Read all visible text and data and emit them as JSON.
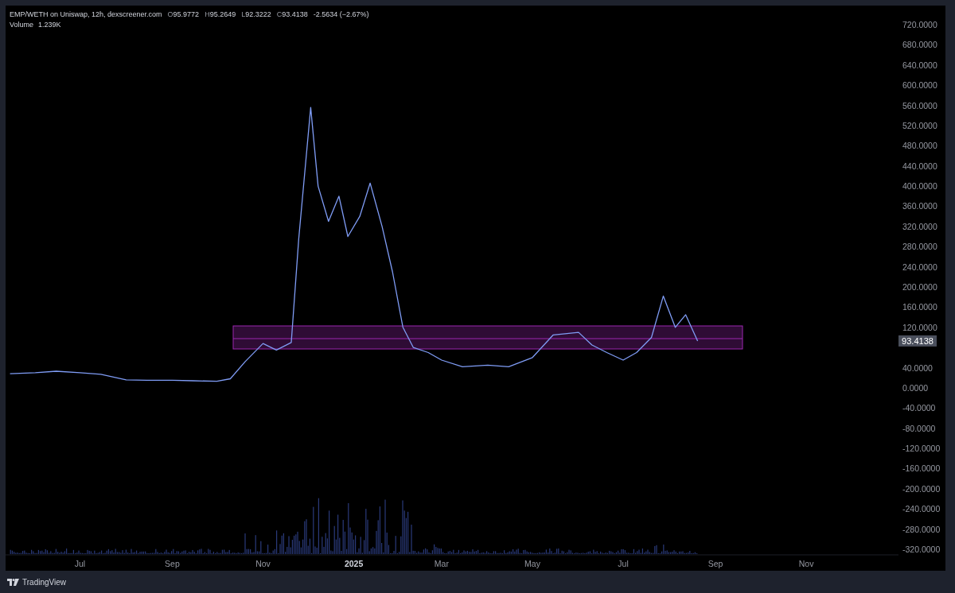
{
  "header": {
    "title": "EMP/WETH on Uniswap, 12h, dexscreener.com",
    "ohlc": [
      {
        "label": "O",
        "value": "95.9772"
      },
      {
        "label": "H",
        "value": "95.2649"
      },
      {
        "label": "L",
        "value": "92.3222"
      },
      {
        "label": "C",
        "value": "93.4138"
      }
    ],
    "change": "-2.5634 (−2.67%)",
    "volume_label": "Volume",
    "volume_value": "1.239K"
  },
  "chart_data": {
    "type": "line",
    "x": [
      "2024-05-15",
      "2024-06-01",
      "2024-06-15",
      "2024-07-01",
      "2024-07-15",
      "2024-08-01",
      "2024-08-15",
      "2024-09-01",
      "2024-09-15",
      "2024-10-01",
      "2024-10-10",
      "2024-10-20",
      "2024-11-01",
      "2024-11-10",
      "2024-11-20",
      "2024-11-25",
      "2024-12-03",
      "2024-12-08",
      "2024-12-15",
      "2024-12-22",
      "2024-12-28",
      "2025-01-05",
      "2025-01-12",
      "2025-01-20",
      "2025-01-27",
      "2025-02-03",
      "2025-02-10",
      "2025-02-20",
      "2025-03-01",
      "2025-03-15",
      "2025-04-01",
      "2025-04-15",
      "2025-05-01",
      "2025-05-15",
      "2025-06-01",
      "2025-06-10",
      "2025-06-20",
      "2025-07-01",
      "2025-07-10",
      "2025-07-20",
      "2025-07-28",
      "2025-08-05",
      "2025-08-12",
      "2025-08-20"
    ],
    "series": [
      {
        "color": "#7f9cf5",
        "values": [
          28,
          30,
          33,
          30,
          27,
          16,
          15,
          15,
          14,
          13,
          18,
          52,
          88,
          75,
          90,
          296,
          556,
          400,
          330,
          380,
          300,
          340,
          406,
          320,
          230,
          120,
          80,
          70,
          55,
          42,
          45,
          42,
          60,
          105,
          110,
          85,
          70,
          55,
          70,
          100,
          182,
          120,
          145,
          93
        ]
      }
    ],
    "xlim": [
      "2024-05-12",
      "2026-01-02"
    ],
    "ylim": [
      -320,
      720
    ],
    "yticks": [
      {
        "value": 720,
        "label": "720.0000"
      },
      {
        "value": 680,
        "label": "680.0000"
      },
      {
        "value": 640,
        "label": "640.0000"
      },
      {
        "value": 600,
        "label": "600.0000"
      },
      {
        "value": 560,
        "label": "560.0000"
      },
      {
        "value": 520,
        "label": "520.0000"
      },
      {
        "value": 480,
        "label": "480.0000"
      },
      {
        "value": 440,
        "label": "440.0000"
      },
      {
        "value": 400,
        "label": "400.0000"
      },
      {
        "value": 360,
        "label": "360.0000"
      },
      {
        "value": 320,
        "label": "320.0000"
      },
      {
        "value": 280,
        "label": "280.0000"
      },
      {
        "value": 240,
        "label": "240.0000"
      },
      {
        "value": 200,
        "label": "200.0000"
      },
      {
        "value": 160,
        "label": "160.0000"
      },
      {
        "value": 120,
        "label": "120.0000"
      },
      {
        "value": 40,
        "label": "40.0000"
      },
      {
        "value": 0,
        "label": "0.0000"
      },
      {
        "value": -40,
        "label": "-40.0000"
      },
      {
        "value": -80,
        "label": "-80.0000"
      },
      {
        "value": -120,
        "label": "-120.0000"
      },
      {
        "value": -160,
        "label": "-160.0000"
      },
      {
        "value": -200,
        "label": "-200.0000"
      },
      {
        "value": -240,
        "label": "-240.0000"
      },
      {
        "value": -280,
        "label": "-280.0000"
      },
      {
        "value": -320,
        "label": "-320.0000"
      }
    ],
    "xticks": [
      {
        "value": "2024-07-01",
        "label": "Jul"
      },
      {
        "value": "2024-09-01",
        "label": "Sep"
      },
      {
        "value": "2024-11-01",
        "label": "Nov"
      },
      {
        "value": "2025-01-01",
        "label": "2025"
      },
      {
        "value": "2025-03-01",
        "label": "Mar"
      },
      {
        "value": "2025-05-01",
        "label": "May"
      },
      {
        "value": "2025-07-01",
        "label": "Jul"
      },
      {
        "value": "2025-09-01",
        "label": "Sep"
      },
      {
        "value": "2025-11-01",
        "label": "Nov"
      }
    ]
  },
  "last_price_label": "93.4138",
  "footer": {
    "brand": "TradingView"
  }
}
